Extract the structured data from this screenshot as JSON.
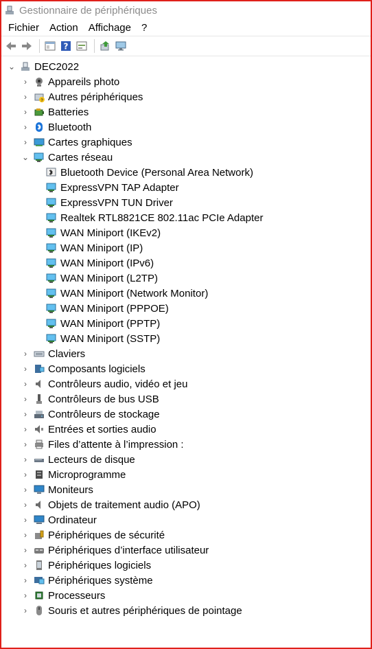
{
  "window": {
    "title": "Gestionnaire de périphériques"
  },
  "menu": [
    "Fichier",
    "Action",
    "Affichage",
    "?"
  ],
  "toolbar": {
    "icons": [
      "back-arrow-icon",
      "forward-arrow-icon",
      "properties-icon",
      "help-icon",
      "view-icon",
      "update-driver-icon",
      "scan-hardware-icon"
    ]
  },
  "tree": {
    "root": {
      "label": "DEC2022",
      "expanded": true
    },
    "categories": [
      {
        "label": "Appareils photo",
        "icon": "camera-icon"
      },
      {
        "label": "Autres périphériques",
        "icon": "unknown-device-icon"
      },
      {
        "label": "Batteries",
        "icon": "battery-icon"
      },
      {
        "label": "Bluetooth",
        "icon": "bluetooth-icon"
      },
      {
        "label": "Cartes graphiques",
        "icon": "display-adapter-icon"
      },
      {
        "label": "Cartes réseau",
        "icon": "network-adapter-icon",
        "expanded": true,
        "children": [
          "Bluetooth Device (Personal Area Network)",
          "ExpressVPN TAP Adapter",
          "ExpressVPN TUN Driver",
          "Realtek RTL8821CE 802.11ac PCIe Adapter",
          "WAN Miniport (IKEv2)",
          "WAN Miniport (IP)",
          "WAN Miniport (IPv6)",
          "WAN Miniport (L2TP)",
          "WAN Miniport (Network Monitor)",
          "WAN Miniport (PPPOE)",
          "WAN Miniport (PPTP)",
          "WAN Miniport (SSTP)"
        ]
      },
      {
        "label": "Claviers",
        "icon": "keyboard-icon"
      },
      {
        "label": "Composants logiciels",
        "icon": "software-component-icon"
      },
      {
        "label": "Contrôleurs audio, vidéo et jeu",
        "icon": "speaker-icon"
      },
      {
        "label": "Contrôleurs de bus USB",
        "icon": "usb-icon"
      },
      {
        "label": "Contrôleurs de stockage",
        "icon": "storage-controller-icon"
      },
      {
        "label": "Entrées et sorties audio",
        "icon": "audio-io-icon"
      },
      {
        "label": "Files d’attente à l’impression :",
        "icon": "printer-icon"
      },
      {
        "label": "Lecteurs de disque",
        "icon": "disk-drive-icon"
      },
      {
        "label": "Microprogramme",
        "icon": "firmware-icon"
      },
      {
        "label": "Moniteurs",
        "icon": "monitor-icon"
      },
      {
        "label": "Objets de traitement audio (APO)",
        "icon": "audio-processing-icon"
      },
      {
        "label": "Ordinateur",
        "icon": "computer-icon"
      },
      {
        "label": "Périphériques de sécurité",
        "icon": "security-device-icon"
      },
      {
        "label": "Périphériques d’interface utilisateur",
        "icon": "hid-icon"
      },
      {
        "label": "Périphériques logiciels",
        "icon": "software-device-icon"
      },
      {
        "label": "Périphériques système",
        "icon": "system-device-icon"
      },
      {
        "label": "Processeurs",
        "icon": "processor-icon"
      },
      {
        "label": "Souris et autres périphériques de pointage",
        "icon": "mouse-icon"
      }
    ]
  }
}
